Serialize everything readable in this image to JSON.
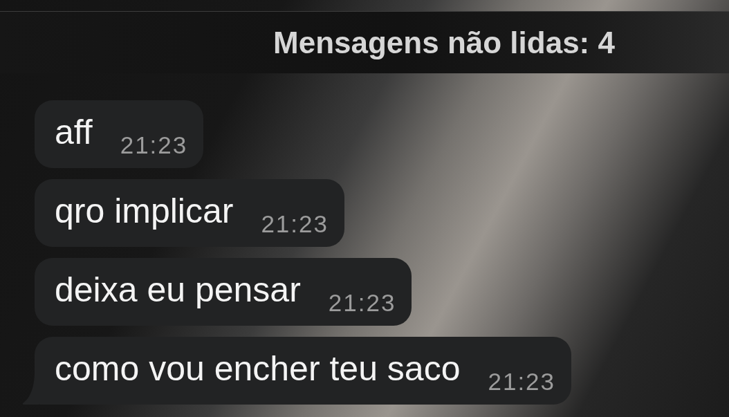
{
  "unread_banner": {
    "text": "Mensagens não lidas: 4"
  },
  "messages": [
    {
      "text": "aff",
      "time": "21:23",
      "tail": false
    },
    {
      "text": "qro implicar",
      "time": "21:23",
      "tail": false
    },
    {
      "text": "deixa eu pensar",
      "time": "21:23",
      "tail": false
    },
    {
      "text": "como vou encher teu saco",
      "time": "21:23",
      "tail": true
    }
  ]
}
